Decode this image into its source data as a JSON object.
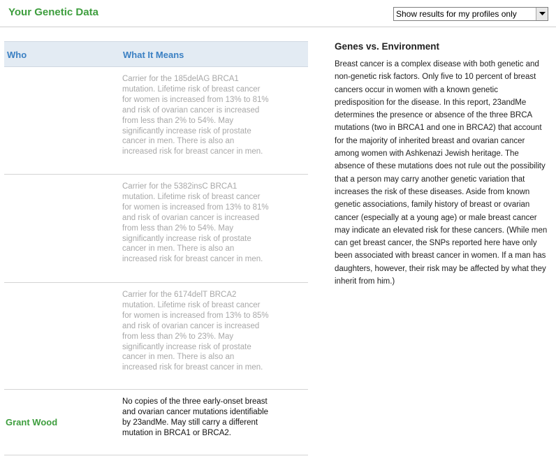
{
  "header": {
    "title": "Your Genetic Data",
    "filter_select": {
      "selected": "Show results for my profiles only"
    }
  },
  "table": {
    "columns": [
      "Who",
      "What It Means"
    ],
    "rows": [
      {
        "who": "",
        "meaning": "Carrier for the 185delAG BRCA1 mutation. Lifetime risk of breast cancer for women is increased from 13% to 81% and risk of ovarian cancer is increased from less than 2% to 54%. May significantly increase risk of prostate cancer in men. There is also an increased risk for breast cancer in men."
      },
      {
        "who": "",
        "meaning": "Carrier for the 5382insC BRCA1 mutation. Lifetime risk of breast cancer for women is increased from 13% to 81% and risk of ovarian cancer is increased from less than 2% to 54%. May significantly increase risk of prostate cancer in men. There is also an increased risk for breast cancer in men."
      },
      {
        "who": "",
        "meaning": "Carrier for the 6174delT BRCA2 mutation. Lifetime risk of breast cancer for women is increased from 13% to 85% and risk of ovarian cancer is increased from less than 2% to 23%. May significantly increase risk of prostate cancer in men. There is also an increased risk for breast cancer in men."
      },
      {
        "who": "Grant Wood",
        "meaning": "No copies of the three early-onset breast and ovarian cancer mutations identifiable by 23andMe. May still carry a different mutation in BRCA1 or BRCA2."
      }
    ]
  },
  "sidebar": {
    "title": "Genes vs. Environment",
    "body": "Breast cancer is a complex disease with both genetic and non-genetic risk factors. Only five to 10 percent of breast cancers occur in women with a known genetic predisposition for the disease. In this report, 23andMe determines the presence or absence of the three BRCA mutations (two in BRCA1 and one in BRCA2) that account for the majority of inherited breast and ovarian cancer among women with Ashkenazi Jewish heritage. The absence of these mutations does not rule out the possibility that a person may carry another genetic variation that increases the risk of these diseases. Aside from known genetic associations, family history of breast or ovarian cancer (especially at a young age) or male breast cancer may indicate an elevated risk for these cancers. (While men can get breast cancer, the SNPs reported here have only been associated with breast cancer in women. If a man has daughters, however, their risk may be affected by what they inherit from him.)"
  },
  "colors": {
    "title_green": "#3e9e3e",
    "header_blue": "#3b80c3",
    "header_bg": "#e3ebf3",
    "muted_text": "#a8a8a8"
  }
}
